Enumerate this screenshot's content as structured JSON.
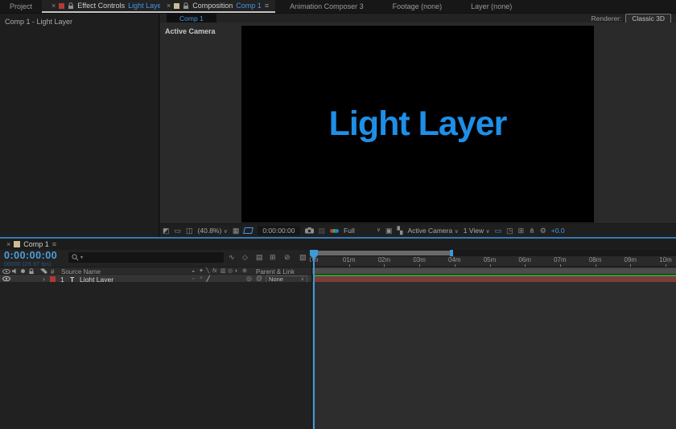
{
  "colors": {
    "accent_blue": "#4796e3",
    "comp_text_blue": "#1e8fe8",
    "timecode_blue": "#4ba0dc",
    "playhead_blue": "#3e9ad6",
    "layer_label_red": "#b53838",
    "layer_bar_maroon": "#7d3c3c",
    "layer_bar_green": "#2aa52a",
    "tab_swatch_tan": "#cdbd94",
    "focus_border_blue": "#3579b5"
  },
  "left_panel": {
    "tab_project": "Project",
    "tab_effect_controls": "Effect Controls",
    "tab_effect_controls_target": "Light Layer",
    "content_title": "Comp 1 - Light Layer"
  },
  "viewer": {
    "tab_composition": "Composition",
    "tab_composition_target": "Comp 1",
    "tab_animation_composer": "Animation Composer 3",
    "tab_footage": "Footage  (none)",
    "tab_layer": "Layer  (none)",
    "renderer_label": "Renderer:",
    "renderer_value": "Classic 3D",
    "subtab": "Comp 1",
    "view_label": "Active Camera",
    "comp_text": "Light Layer",
    "toolbar": {
      "zoom": "(40.8%)",
      "timecode": "0:00:00:00",
      "resolution": "Full",
      "camera_view": "Active Camera",
      "layout": "1 View",
      "exposure": "+0.0"
    }
  },
  "timeline": {
    "tab": "Comp 1",
    "timecode": "0:00:00:00",
    "frames_info": "00000 (29.97 fps)",
    "ruler_labels": [
      "0m",
      "01m",
      "02m",
      "03m",
      "04m",
      "05m",
      "06m",
      "07m",
      "08m",
      "09m",
      "10m"
    ],
    "columns": {
      "index": "#",
      "source": "Source Name",
      "parent": "Parent & Link"
    },
    "layers": [
      {
        "index": "1",
        "type_badge": "T",
        "name": "Light Layer",
        "parent": "None",
        "label_color": "#b53838"
      }
    ]
  }
}
